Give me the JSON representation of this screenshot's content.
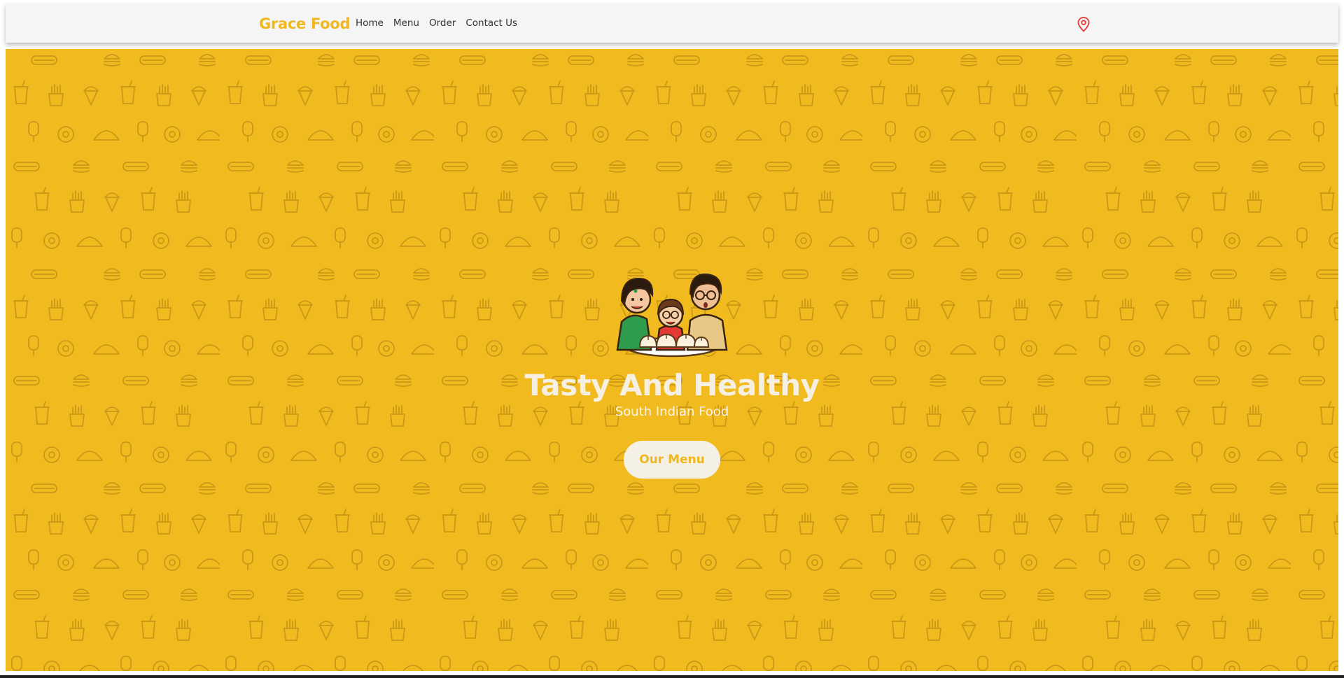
{
  "navbar": {
    "brand": "Grace Food",
    "links": [
      {
        "label": "Home"
      },
      {
        "label": "Menu"
      },
      {
        "label": "Order"
      },
      {
        "label": "Contact Us"
      }
    ],
    "location_icon": "map-pin-icon"
  },
  "hero": {
    "title": "Tasty And Healthy",
    "subtitle": "South Indian Food",
    "button_label": "Our Menu",
    "background_color": "#f1bb1f",
    "pattern_icons": [
      "burger-icon",
      "hotdog-icon",
      "cup-icon",
      "fries-icon",
      "ice-cream-cone-icon",
      "popsicle-icon",
      "donut-icon",
      "taco-icon"
    ],
    "illustration": "family-eating-dumplings-icon"
  },
  "colors": {
    "accent": "#f0b820",
    "navbar_bg": "#f5f5f5",
    "location_icon": "#e53935",
    "button_bg": "#f5f0e6"
  }
}
